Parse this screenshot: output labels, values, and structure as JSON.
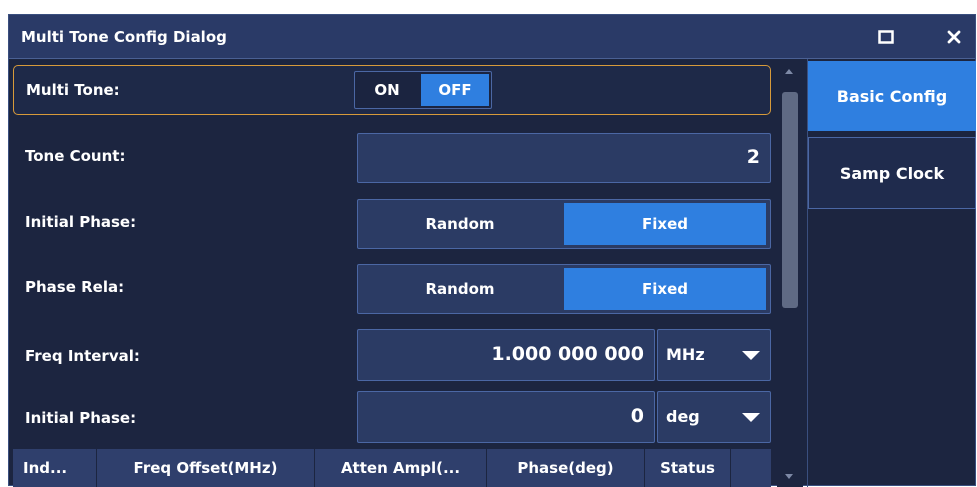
{
  "dialog": {
    "title": "Multi Tone Config Dialog"
  },
  "title_buttons": {
    "maximize_icon": "maximize-icon",
    "close_icon": "close-icon"
  },
  "rows": {
    "multi_tone": {
      "label": "Multi Tone:",
      "on": "ON",
      "off": "OFF",
      "selected": "OFF"
    },
    "tone_count": {
      "label": "Tone Count:",
      "value": "2"
    },
    "initial_phase_mode": {
      "label": "Initial Phase:",
      "option1": "Random",
      "option2": "Fixed",
      "selected": "Fixed"
    },
    "phase_rela": {
      "label": "Phase Rela:",
      "option1": "Random",
      "option2": "Fixed",
      "selected": "Fixed"
    },
    "freq_interval": {
      "label": "Freq Interval:",
      "value": "1.000 000 000",
      "unit": "MHz"
    },
    "initial_phase_value": {
      "label": "Initial Phase:",
      "value": "0",
      "unit": "deg"
    }
  },
  "table": {
    "headers": [
      "Ind...",
      "Freq Offset(MHz)",
      "Atten Ampl(...",
      "Phase(deg)",
      "Status"
    ]
  },
  "side_menu": {
    "items": [
      {
        "label": "Basic Config",
        "active": true
      },
      {
        "label": "Samp Clock",
        "active": false
      }
    ]
  },
  "colors": {
    "background": "#1c2540",
    "titlebar": "#2a3a67",
    "accent": "#2f7fe0",
    "field": "#2b3b64",
    "highlight_border": "#d79a3a"
  }
}
